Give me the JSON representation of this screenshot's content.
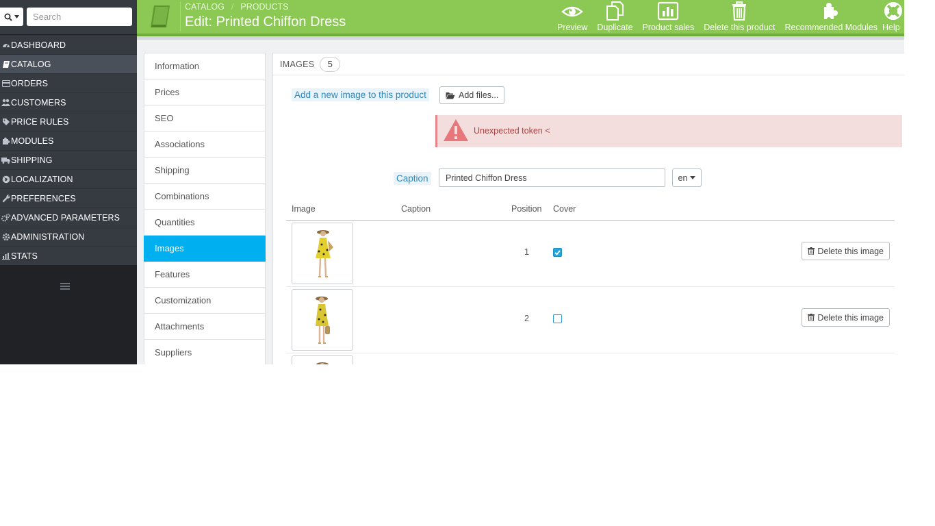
{
  "sidebar": {
    "search": {
      "placeholder": "Search"
    },
    "menu": [
      {
        "label": "DASHBOARD",
        "icon": "dashboard-icon"
      },
      {
        "label": "CATALOG",
        "icon": "book-icon",
        "active": true
      },
      {
        "label": "ORDERS",
        "icon": "credit-card-icon"
      },
      {
        "label": "CUSTOMERS",
        "icon": "users-icon"
      },
      {
        "label": "PRICE RULES",
        "icon": "tags-icon"
      },
      {
        "label": "MODULES",
        "icon": "puzzle-icon"
      },
      {
        "label": "SHIPPING",
        "icon": "truck-icon"
      },
      {
        "label": "LOCALIZATION",
        "icon": "globe-icon"
      },
      {
        "label": "PREFERENCES",
        "icon": "wrench-icon"
      },
      {
        "label": "ADVANCED PARAMETERS",
        "icon": "cogs-icon"
      },
      {
        "label": "ADMINISTRATION",
        "icon": "cog-icon"
      },
      {
        "label": "STATS",
        "icon": "bar-chart-icon"
      }
    ]
  },
  "header": {
    "breadcrumb": [
      "CATALOG",
      "PRODUCTS"
    ],
    "title": "Edit: Printed Chiffon Dress",
    "toolbar": [
      {
        "label": "Preview",
        "icon": "eye-icon"
      },
      {
        "label": "Duplicate",
        "icon": "copy-icon"
      },
      {
        "label": "Product sales",
        "icon": "bar-chart-icon"
      },
      {
        "label": "Delete this product",
        "icon": "trash-icon"
      },
      {
        "label": "Recommended Modules",
        "icon": "puzzle-icon"
      },
      {
        "label": "Help",
        "icon": "lifebuoy-icon"
      }
    ]
  },
  "tabs": [
    {
      "label": "Information"
    },
    {
      "label": "Prices"
    },
    {
      "label": "SEO"
    },
    {
      "label": "Associations"
    },
    {
      "label": "Shipping"
    },
    {
      "label": "Combinations"
    },
    {
      "label": "Quantities"
    },
    {
      "label": "Images",
      "active": true
    },
    {
      "label": "Features"
    },
    {
      "label": "Customization"
    },
    {
      "label": "Attachments"
    },
    {
      "label": "Suppliers"
    }
  ],
  "images_panel": {
    "heading": "IMAGES",
    "count": "5",
    "add_label": "Add a new image to this product",
    "add_files_label": "Add files...",
    "error_text": "Unexpected token <",
    "caption_label": "Caption",
    "caption_value": "Printed Chiffon Dress",
    "language": "en",
    "table": {
      "columns": [
        "Image",
        "Caption",
        "Position",
        "Cover"
      ],
      "rows": [
        {
          "position": "1",
          "cover": true,
          "delete_label": "Delete this image"
        },
        {
          "position": "2",
          "cover": false,
          "delete_label": "Delete this image"
        }
      ]
    }
  },
  "colors": {
    "header": "#8bc954",
    "sidebar": "#363a41",
    "active_tab": "#00aff0",
    "alert_bg": "#f3dddd",
    "alert_text": "#a94442"
  }
}
